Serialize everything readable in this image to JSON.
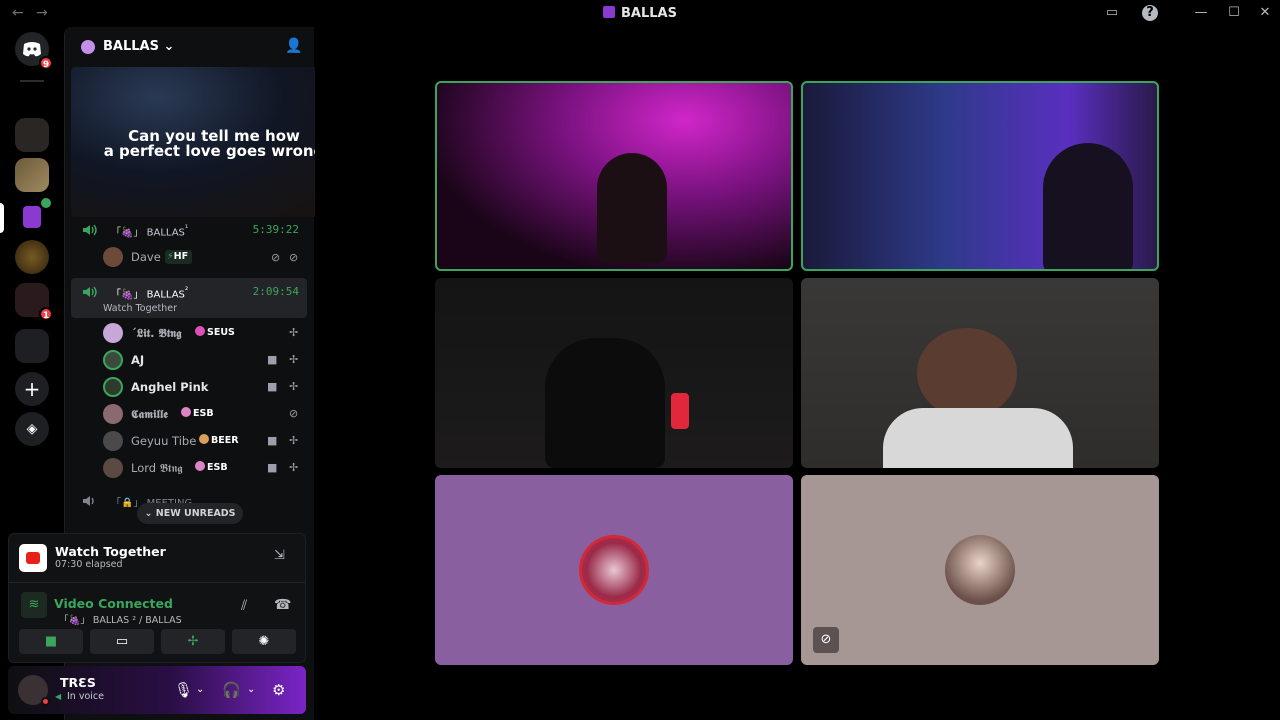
{
  "titlebar": {
    "title": "BALLAS",
    "back": "←",
    "forward": "→"
  },
  "rail": {
    "home_badge": "9",
    "dm_badge": "1"
  },
  "server": {
    "name": "BALLAS",
    "banner_line1": "Can you tell me how",
    "banner_line2": "a perfect love goes wrong"
  },
  "channels": [
    {
      "prefix": "「🍇」",
      "name": "BALLAS",
      "sup": "¹",
      "time": "5:39:22"
    },
    {
      "prefix": "「🍇」",
      "name": "BALLAS",
      "sup": "²",
      "time": "2:09:54",
      "activity": "Watch Together"
    },
    {
      "prefix": "「🔒」",
      "name": "MEETING"
    }
  ],
  "channel1_members": [
    {
      "name": "Dave",
      "tag": "HF",
      "tag_icon": "⚡"
    }
  ],
  "channel2_members": [
    {
      "name": "ˊ𝕷𝖎𝖙. 𝕭𝖙𝖓𝖌",
      "tag": "SEUS"
    },
    {
      "name": "AJ"
    },
    {
      "name": "Anghel Pink"
    },
    {
      "name": "𝕮𝖆𝖒𝖎𝖑𝖑𝖊",
      "tag": "ESB"
    },
    {
      "name": "Geyuu Tibe",
      "tag": "BEER"
    },
    {
      "name": "Lord 𝕭𝖙𝖓𝖌",
      "tag": "ESB"
    }
  ],
  "new_unreads": "NEW UNREADS",
  "activity": {
    "title": "Watch Together",
    "elapsed": "07:30 elapsed",
    "status": "Video Connected",
    "path": "「🍇」 BALLAS ² / BALLAS"
  },
  "user": {
    "name": "TRƐS",
    "status": "In voice"
  },
  "colors": {
    "accent": "#8a3ad1",
    "connected": "#3ba55d",
    "tile_purple": "#8a5fa0",
    "tile_taupe": "#a69694"
  }
}
